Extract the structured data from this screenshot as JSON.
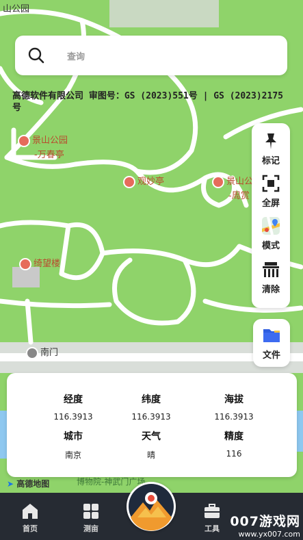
{
  "map": {
    "top_label": "山公园",
    "pois": [
      {
        "name": "景山公园",
        "sub": "-万春亭"
      },
      {
        "name": "观妙亭"
      },
      {
        "name": "景山公",
        "sub": "-周赏"
      },
      {
        "name": "绮望楼"
      },
      {
        "name": "南门"
      },
      {
        "name": "博物院-",
        "sub": "神武门广场"
      }
    ],
    "amap_logo": "高德地图"
  },
  "search": {
    "placeholder": "查询",
    "icon": "search-icon"
  },
  "approval": {
    "text": "高德软件有限公司  审图号：GS (2023)551号 | GS (2023)2175号"
  },
  "tools": [
    {
      "label": "标记",
      "icon": "pin-icon"
    },
    {
      "label": "全屏",
      "icon": "fullscreen-icon"
    },
    {
      "label": "模式",
      "icon": "map-mode-icon"
    },
    {
      "label": "清除",
      "icon": "clear-icon"
    }
  ],
  "file": {
    "label": "文件",
    "icon": "folder-icon"
  },
  "info": {
    "longitude": {
      "label": "经度",
      "value": "116.3913"
    },
    "latitude": {
      "label": "纬度",
      "value": "116.3913"
    },
    "altitude": {
      "label": "海拔",
      "value": "116.3913"
    },
    "city": {
      "label": "城市",
      "value": "南京"
    },
    "weather": {
      "label": "天气",
      "value": "晴"
    },
    "accuracy": {
      "label": "精度",
      "value": "116"
    }
  },
  "nav": [
    {
      "label": "首页",
      "icon": "home-icon"
    },
    {
      "label": "测亩",
      "icon": "grid-icon"
    },
    {
      "label": "工具",
      "icon": "toolbox-icon"
    }
  ],
  "watermark": {
    "main": "007游戏网",
    "url": "www.yx007.com"
  },
  "colors": {
    "map_green": "#8fd36a",
    "nav_bg": "#262b33",
    "poi_red": "#b84b2e"
  }
}
